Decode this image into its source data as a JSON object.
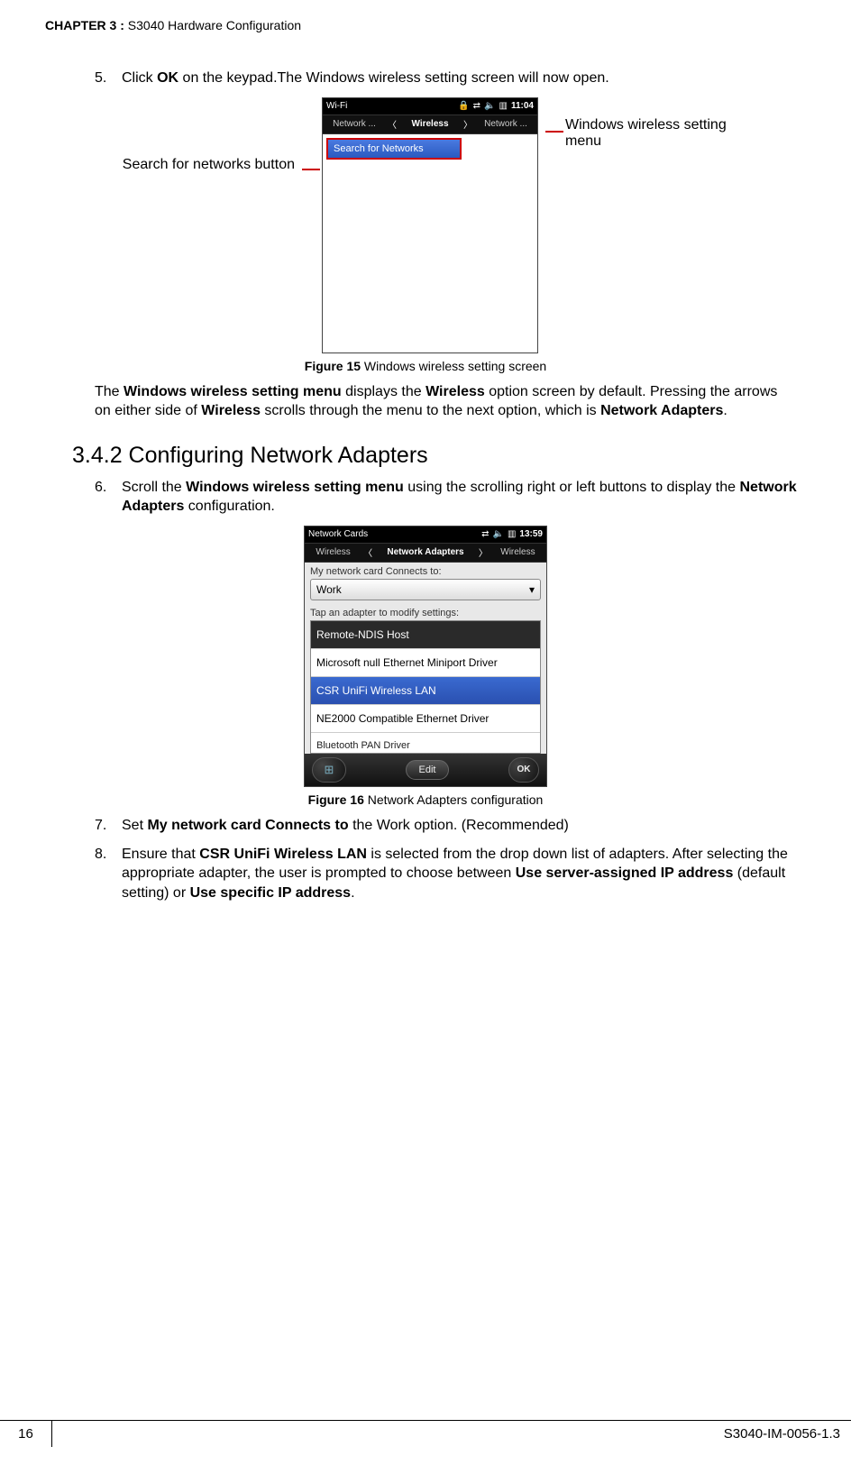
{
  "chapter": {
    "label": "CHAPTER 3 :",
    "title": " S3040 Hardware Configuration"
  },
  "step5": {
    "num": "5.",
    "pre": "Click ",
    "bold1": "OK",
    "post": " on the keypad.The Windows wireless setting screen will now open."
  },
  "fig1": {
    "ann_left": "Search for networks button",
    "ann_right": "Windows wireless setting menu",
    "status_title": "Wi-Fi",
    "time": "11:04",
    "menu_left": "Network ...",
    "menu_center": "Wireless",
    "menu_right": "Network ...",
    "search_btn": "Search for Networks",
    "caption_bold": "Figure 15",
    "caption_text": " Windows wireless setting screen"
  },
  "para1": {
    "pre": "The ",
    "b1": "Windows wireless setting menu",
    "mid1": " displays the ",
    "b2": "Wireless",
    "mid2": " option screen by default. Pressing the arrows on either side of ",
    "b3": "Wireless",
    "mid3": " scrolls through the menu to the next option, which is ",
    "b4": "Network Adapters",
    "post": "."
  },
  "subsection": "3.4.2  Configuring Network Adapters",
  "step6": {
    "num": "6.",
    "pre": "Scroll the ",
    "b1": "Windows wireless setting menu",
    "mid": " using the scrolling right or left buttons to display the ",
    "b2": "Network Adapters",
    "post": " configuration."
  },
  "fig2": {
    "status_title": "Network Cards",
    "time": "13:59",
    "menu_left": "Wireless",
    "menu_center": "Network Adapters",
    "menu_right": "Wireless",
    "label1": "My network card Connects to:",
    "select_value": "Work",
    "label2": "Tap an adapter to modify settings:",
    "items": [
      "Remote-NDIS Host",
      "Microsoft null Ethernet Miniport Driver",
      "CSR UniFi Wireless LAN",
      "NE2000 Compatible Ethernet Driver",
      "Bluetooth PAN Driver"
    ],
    "bottom_edit": "Edit",
    "bottom_ok": "OK",
    "caption_bold": "Figure 16",
    "caption_text": " Network Adapters configuration"
  },
  "step7": {
    "num": "7.",
    "pre": "Set ",
    "b1": "My network card Connects to",
    "post": " the Work option. (Recommended)"
  },
  "step8": {
    "num": "8.",
    "pre": "Ensure that ",
    "b1": "CSR UniFi Wireless LAN",
    "mid1": " is selected from the drop down list of adapters. After selecting the appropriate adapter, the user is prompted to choose between ",
    "b2": "Use server-assigned IP address",
    "mid2": " (default setting) or ",
    "b3": "Use specific IP address",
    "post": "."
  },
  "footer": {
    "page": "16",
    "doc": "S3040-IM-0056-1.3"
  }
}
